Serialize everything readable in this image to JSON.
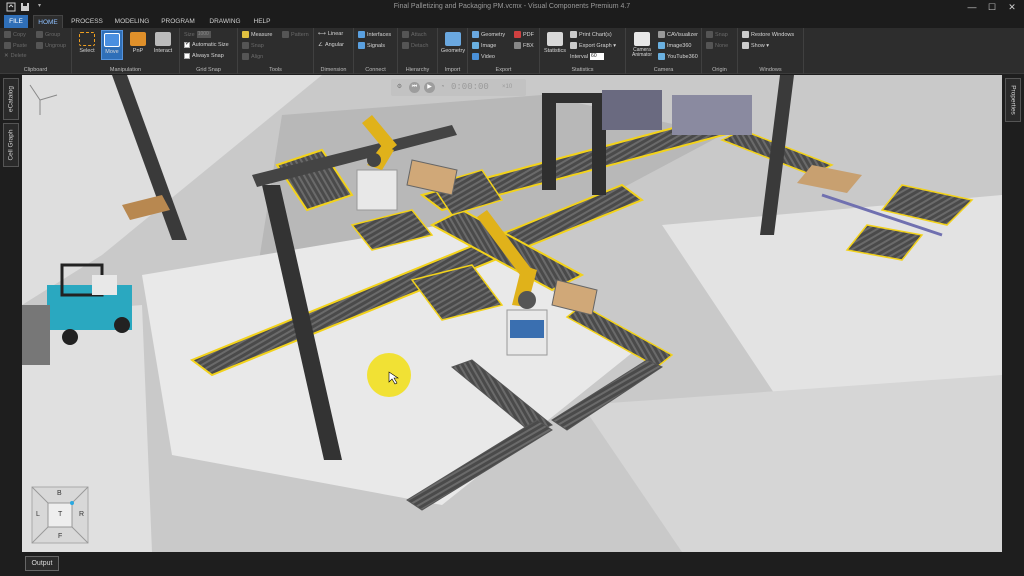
{
  "window": {
    "title": "Final Palletizing and Packaging PM.vcmx - Visual Components Premium 4.7",
    "minimize": "—",
    "maximize": "☐",
    "close": "✕"
  },
  "menu": {
    "tabs": [
      "FILE",
      "HOME",
      "PROCESS",
      "MODELING",
      "PROGRAM",
      "DRAWING",
      "HELP"
    ],
    "active": "HOME"
  },
  "ribbon": {
    "clipboard": {
      "label": "Clipboard",
      "items": [
        "Copy",
        "Group",
        "Paste",
        "Ungroup",
        "Delete"
      ]
    },
    "manipulation": {
      "label": "Manipulation",
      "select": "Select",
      "move": "Move",
      "pnp": "PnP",
      "interact": "Interact"
    },
    "grid_snap": {
      "label": "Grid Snap",
      "size_label": "Size",
      "size_value": "1000",
      "automatic_size": "Automatic Size",
      "always_snap": "Always Snap"
    },
    "tools": {
      "label": "Tools",
      "measure": "Measure",
      "pattern": "Pattern",
      "snap": "Snap",
      "align": "Align"
    },
    "dimension": {
      "label": "Dimension",
      "linear": "Linear",
      "angular": "Angular"
    },
    "connect": {
      "label": "Connect",
      "interfaces": "Interfaces",
      "signals": "Signals"
    },
    "hierarchy": {
      "label": "Hierarchy",
      "attach": "Attach",
      "detach": "Detach"
    },
    "import": {
      "label": "Import",
      "geometry": "Geometry"
    },
    "export": {
      "label": "Export",
      "geometry": "Geometry",
      "pdf": "PDF",
      "image": "Image",
      "fbx": "FBX",
      "video": "Video"
    },
    "statistics": {
      "label": "Statistics",
      "statistics": "Statistics",
      "print_chart": "Print Chart(s)",
      "export_graph": "Export Graph ▾",
      "interval_label": "Interval",
      "interval_value": "60"
    },
    "camera": {
      "label": "Camera",
      "camera_animator": "Camera Animator",
      "cavisualizer": "CAVisualizer",
      "image360": "Image360",
      "youtube360": "YouTube360"
    },
    "origin": {
      "label": "Origin",
      "snap": "Snap",
      "none": "None"
    },
    "windows": {
      "label": "Windows",
      "restore": "Restore Windows",
      "show": "Show ▾"
    }
  },
  "panels": {
    "left": [
      "eCatalog",
      "Cell Graph"
    ],
    "right": [
      "Properties"
    ],
    "bottom": "Output"
  },
  "playback": {
    "time": "0:00:00",
    "speed": "×10"
  },
  "navcube": {
    "top": "B",
    "left": "L",
    "center": "T",
    "right": "R",
    "bottom": "F"
  },
  "colors": {
    "accent": "#2f6fb8",
    "conveyor_rail": "#f2d21b",
    "robot": "#e0b21a",
    "robot_base": "#3a6fb0",
    "forklift": "#2aa8c0",
    "floor": "#c9c9c9",
    "zone": "#e9e9e9"
  }
}
